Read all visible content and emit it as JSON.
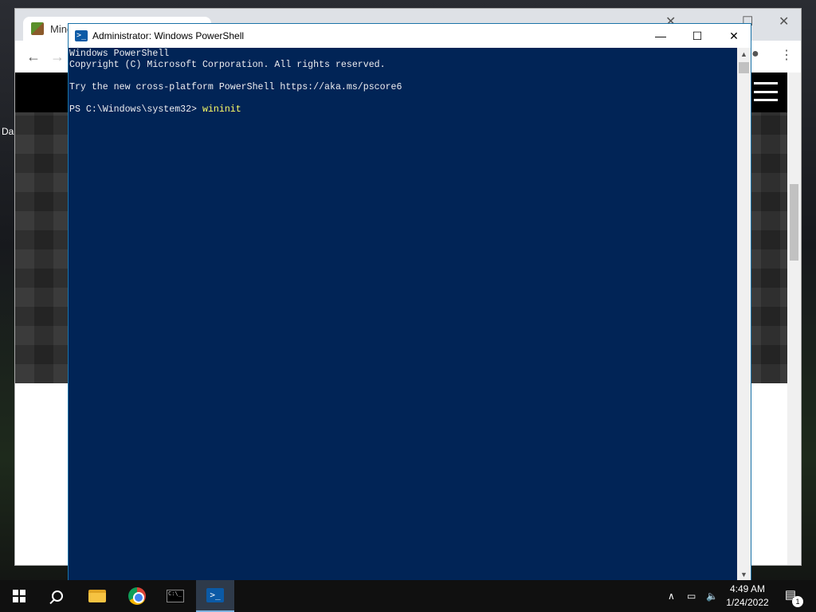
{
  "desktop": {
    "label": "Da"
  },
  "browser": {
    "tab_title": "Mine",
    "back_icon": "arrow-left-icon",
    "forward_icon": "arrow-right-icon"
  },
  "powershell": {
    "title": "Administrator: Windows PowerShell",
    "lines": [
      "Windows PowerShell",
      "Copyright (C) Microsoft Corporation. All rights reserved.",
      "",
      "Try the new cross-platform PowerShell https://aka.ms/pscore6",
      ""
    ],
    "prompt": "PS C:\\Windows\\system32> ",
    "command": "wininit",
    "colors": {
      "background": "#012456",
      "text": "#eeedf0",
      "command": "#ffff66"
    }
  },
  "taskbar": {
    "apps": [
      "start",
      "search",
      "file-explorer",
      "chrome",
      "command-prompt",
      "powershell"
    ],
    "time": "4:49 AM",
    "date": "1/24/2022",
    "notification_count": "1"
  }
}
